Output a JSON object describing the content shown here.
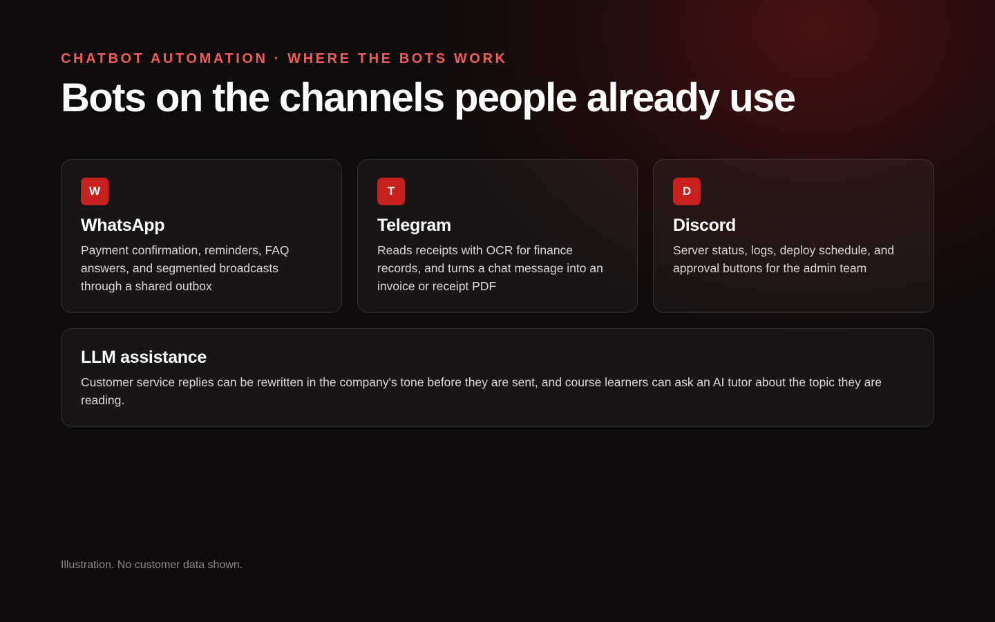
{
  "header": {
    "eyebrow": "CHATBOT AUTOMATION · WHERE THE BOTS WORK",
    "title": "Bots on the channels people already use"
  },
  "channels": [
    {
      "badge": "W",
      "title": "WhatsApp",
      "description": "Payment confirmation, reminders, FAQ answers, and segmented broadcasts through a shared outbox"
    },
    {
      "badge": "T",
      "title": "Telegram",
      "description": "Reads receipts with OCR for finance records, and turns a chat message into an invoice or receipt PDF"
    },
    {
      "badge": "D",
      "title": "Discord",
      "description": "Server status, logs, deploy schedule, and approval buttons for the admin team"
    }
  ],
  "llm": {
    "title": "LLM assistance",
    "description": "Customer service replies can be rewritten in the company's tone before they are sent, and course learners can ask an AI tutor about the topic they are reading."
  },
  "footer": {
    "note": "Illustration. No customer data shown."
  },
  "colors": {
    "accent": "#f25c5c",
    "badge": "#c8201f",
    "background": "#0d0b0c"
  }
}
